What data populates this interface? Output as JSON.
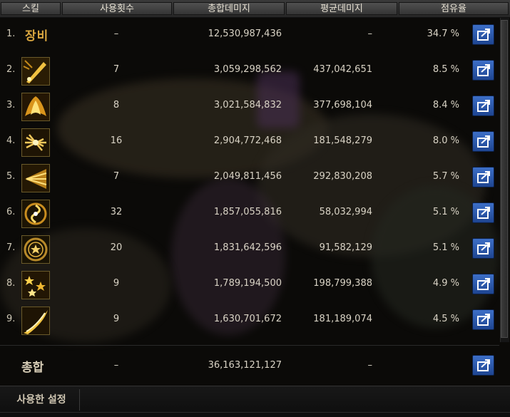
{
  "columns": {
    "skill": "스킬",
    "uses": "사용횟수",
    "total_damage": "총합데미지",
    "avg_damage": "평균데미지",
    "share": "점유율"
  },
  "rows": [
    {
      "rank": "1.",
      "name": "장비",
      "icon": "equipment-label",
      "uses": "–",
      "total": "12,530,987,436",
      "avg": "–",
      "share": "34.7 %"
    },
    {
      "rank": "2.",
      "icon": "skill-icon-blade",
      "uses": "7",
      "total": "3,059,298,562",
      "avg": "437,042,651",
      "share": "8.5 %"
    },
    {
      "rank": "3.",
      "icon": "skill-icon-flame",
      "uses": "8",
      "total": "3,021,584,832",
      "avg": "377,698,104",
      "share": "8.4 %"
    },
    {
      "rank": "4.",
      "icon": "skill-icon-burst",
      "uses": "16",
      "total": "2,904,772,468",
      "avg": "181,548,279",
      "share": "8.0 %"
    },
    {
      "rank": "5.",
      "icon": "skill-icon-rays",
      "uses": "7",
      "total": "2,049,811,456",
      "avg": "292,830,208",
      "share": "5.7 %"
    },
    {
      "rank": "6.",
      "icon": "skill-icon-vortex",
      "uses": "32",
      "total": "1,857,055,816",
      "avg": "58,032,994",
      "share": "5.1 %"
    },
    {
      "rank": "7.",
      "icon": "skill-icon-star-ring",
      "uses": "20",
      "total": "1,831,642,596",
      "avg": "91,582,129",
      "share": "5.1 %"
    },
    {
      "rank": "8.",
      "icon": "skill-icon-stars",
      "uses": "9",
      "total": "1,789,194,500",
      "avg": "198,799,388",
      "share": "4.9 %"
    },
    {
      "rank": "9.",
      "icon": "skill-icon-slash",
      "uses": "9",
      "total": "1,630,701,672",
      "avg": "181,189,074",
      "share": "4.5 %"
    }
  ],
  "total_row": {
    "label": "총합",
    "uses": "–",
    "total": "36,163,121,127",
    "avg": "–"
  },
  "footer": {
    "tab_label": "사용한 설정"
  },
  "colors": {
    "accent_gold": "#d9a640",
    "share_button": "#2b5aa8"
  }
}
